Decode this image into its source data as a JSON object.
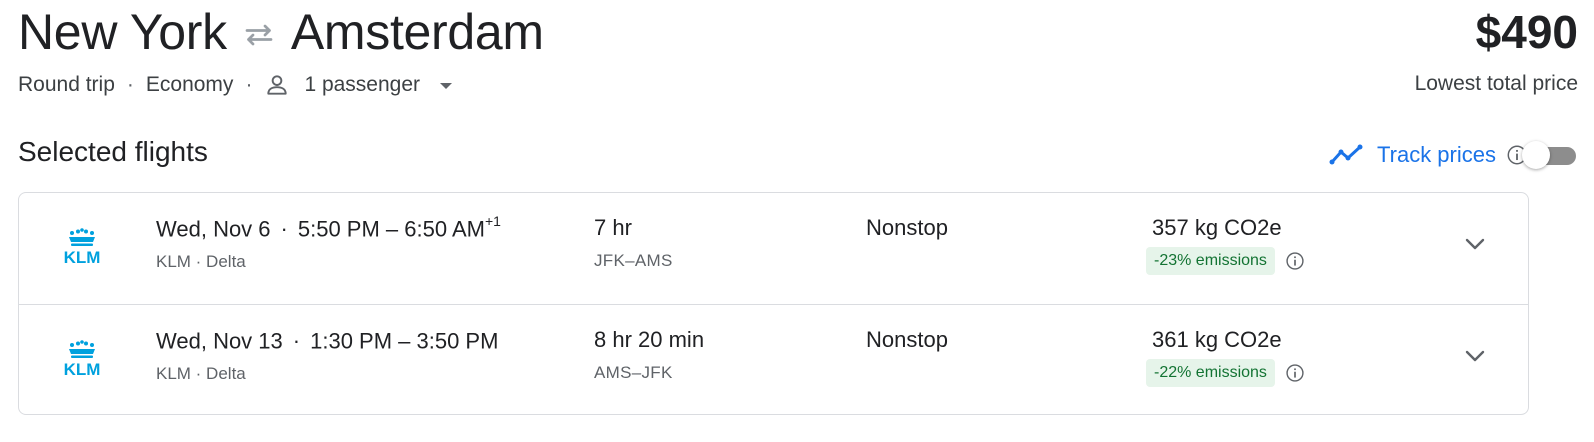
{
  "route": {
    "origin": "New York",
    "destination": "Amsterdam",
    "swap_icon": "swap-arrows-icon"
  },
  "price": {
    "amount": "$490",
    "label": "Lowest total price"
  },
  "trip_options": {
    "trip_type": "Round trip",
    "separator": "·",
    "cabin": "Economy",
    "passengers": "1 passenger"
  },
  "section": {
    "title": "Selected flights"
  },
  "track_prices": {
    "label": "Track prices",
    "enabled": false,
    "accent_color": "#1a73e8"
  },
  "flights": [
    {
      "date": "Wed, Nov 6",
      "dot": "·",
      "times": "5:50 PM – 6:50 AM",
      "day_offset": "+1",
      "airlines": "KLM · Delta",
      "duration": "7 hr",
      "airports": "JFK–AMS",
      "stops": "Nonstop",
      "co2": "357 kg CO2e",
      "emissions": "-23% emissions",
      "logo_text": "KLM"
    },
    {
      "date": "Wed, Nov 13",
      "dot": "·",
      "times": "1:30 PM – 3:50 PM",
      "day_offset": "",
      "airlines": "KLM · Delta",
      "duration": "8 hr 20 min",
      "airports": "AMS–JFK",
      "stops": "Nonstop",
      "co2": "361 kg CO2e",
      "emissions": "-22% emissions",
      "logo_text": "KLM"
    }
  ],
  "colors": {
    "emissions_badge_bg": "#e6f4ea",
    "emissions_badge_text": "#137333",
    "klm_blue": "#00a1de"
  }
}
